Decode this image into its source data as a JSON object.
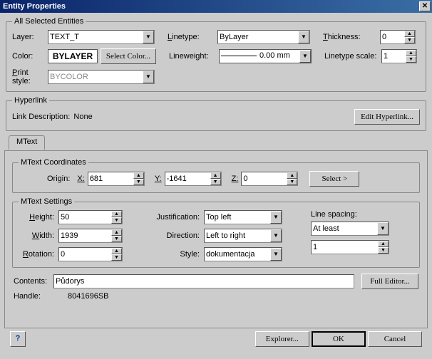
{
  "window": {
    "title": "Entity Properties"
  },
  "groups": {
    "all_selected": "All Selected Entities",
    "hyperlink": "Hyperlink",
    "mtext_coords": "MText Coordinates",
    "mtext_settings": "MText Settings"
  },
  "labels": {
    "layer": "Layer:",
    "color": "Color:",
    "print_style": "rint style:",
    "linetype": "inetype:",
    "lineweight": "Lineweight:",
    "thickness": "hickness:",
    "linetype_scale": "Linetype scale:",
    "link_desc": "Link Description:",
    "origin": "Origin:",
    "x": "X:",
    "y": "Y:",
    "z": "Z:",
    "height": "eight:",
    "width": "idth:",
    "rotation": "otation:",
    "justification": "Justification:",
    "direction": "Direction:",
    "style": "Style:",
    "line_spacing": "Line spacing:",
    "contents": "Contents:",
    "handle": "Handle:"
  },
  "buttons": {
    "select_color": "Select Color...",
    "edit_hyperlink": "Edit Hyperlink...",
    "select": "Select  >",
    "full_editor": "Full Editor...",
    "explorer": "Explorer...",
    "ok": "OK",
    "cancel": "Cancel",
    "help": "?"
  },
  "tabs": {
    "mtext": "MText"
  },
  "values": {
    "layer": "TEXT_T",
    "color": "BYLAYER",
    "print_style": "BYCOLOR",
    "linetype": "ByLayer",
    "lineweight": "0.00 mm",
    "thickness": "0",
    "linetype_scale": "1",
    "link_desc_value": "None",
    "origin_x": "681",
    "origin_y": "-1641",
    "origin_z": "0",
    "height": "50",
    "width": "1939",
    "rotation": "0",
    "justification": "Top left",
    "direction": "Left to right",
    "style": "dokumentacja",
    "line_spacing_mode": "At least",
    "line_spacing_factor": "1",
    "contents": "Půdorys",
    "handle": "8041696SB"
  }
}
